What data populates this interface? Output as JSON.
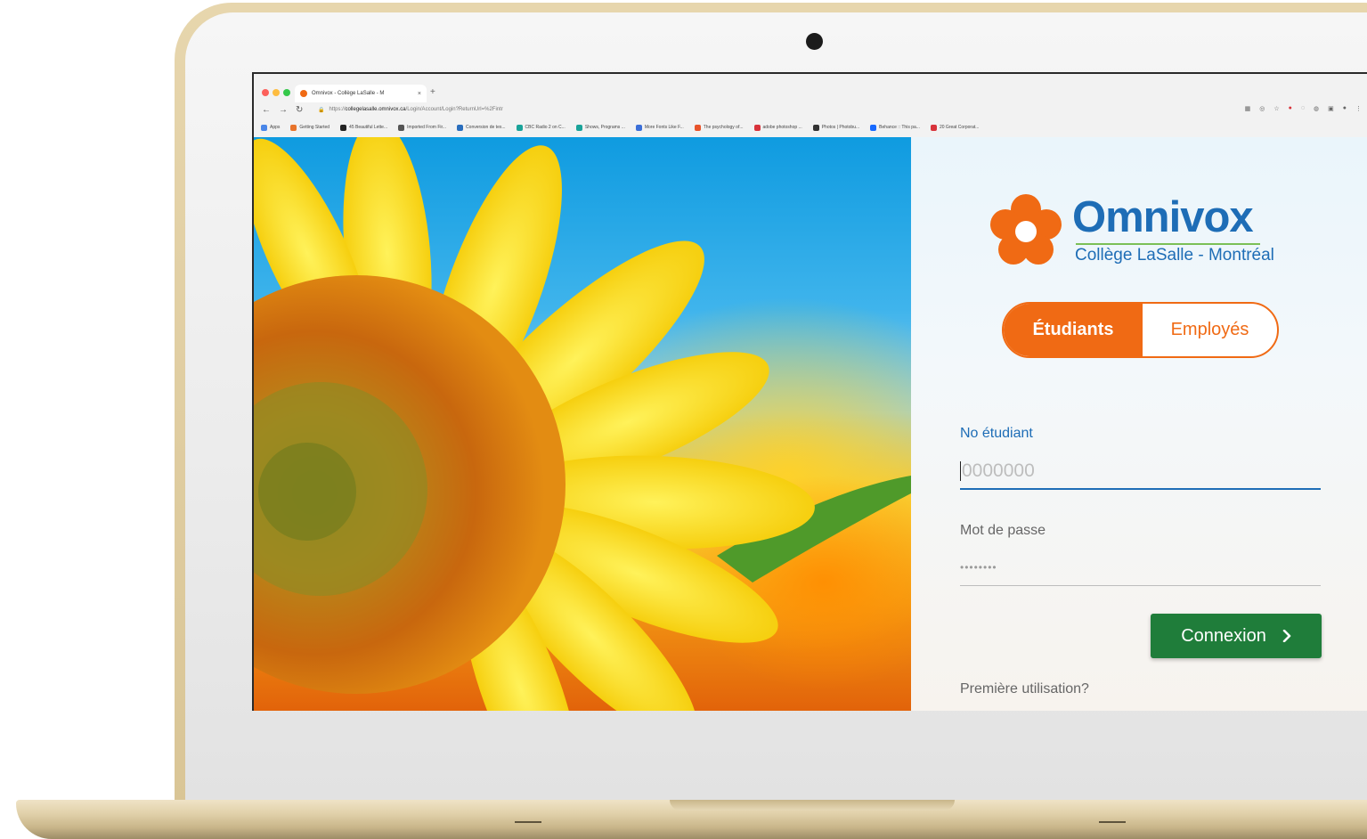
{
  "browser": {
    "tab_title": "Omnivox - Collège LaSalle - M",
    "tab_close": "×",
    "new_tab": "+",
    "url_prefix": "https://",
    "url_host": "collegelasalle.omnivox.ca",
    "url_path": "/Login/Account/Login?ReturnUrl=%2Fintr",
    "bookmarks": [
      {
        "label": "Apps",
        "color": "#4a86e8"
      },
      {
        "label": "Getting Started",
        "color": "#e8742b"
      },
      {
        "label": "45 Beautiful Lette...",
        "color": "#222222"
      },
      {
        "label": "Imported From Fir...",
        "color": "#555555"
      },
      {
        "label": "Conversion de tex...",
        "color": "#2a6ebd"
      },
      {
        "label": "CBC Radio 2 on C...",
        "color": "#1aa39a"
      },
      {
        "label": "Shows, Programs ...",
        "color": "#1aa39a"
      },
      {
        "label": "More Fonts Like F...",
        "color": "#3b6fd8"
      },
      {
        "label": "The psychology of...",
        "color": "#e8542b"
      },
      {
        "label": "adobe photoshop ...",
        "color": "#d8333b"
      },
      {
        "label": "Photos | Photobu...",
        "color": "#333333"
      },
      {
        "label": "Behance :: This pa...",
        "color": "#1769ff"
      },
      {
        "label": "20 Great Corporat...",
        "color": "#d8333b"
      }
    ]
  },
  "login": {
    "brand": "Omnivox",
    "subtitle": "Collège LaSalle - Montréal",
    "toggle_active": "Étudiants",
    "toggle_inactive": "Employés",
    "student_label": "No étudiant",
    "student_placeholder": "0000000",
    "password_label": "Mot de passe",
    "password_mask": "••••••••",
    "submit_label": "Connexion",
    "submit_icon": "chevron-right-icon",
    "first_use_link": "Première utilisation?"
  },
  "colors": {
    "accent_orange": "#f06a14",
    "brand_blue": "#1e6db6",
    "button_green": "#1f7d3a"
  }
}
